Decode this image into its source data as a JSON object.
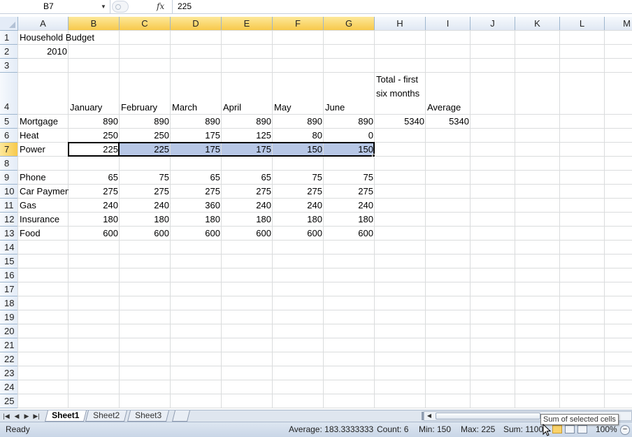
{
  "formula_bar": {
    "name_box": "B7",
    "fx_label": "fx",
    "content": "225"
  },
  "columns": [
    "A",
    "B",
    "C",
    "D",
    "E",
    "F",
    "G",
    "H",
    "I",
    "J",
    "K",
    "L",
    "M"
  ],
  "rows": [
    "1",
    "2",
    "3",
    "4",
    "5",
    "6",
    "7",
    "8",
    "9",
    "10",
    "11",
    "12",
    "13",
    "14",
    "15",
    "16",
    "17",
    "18",
    "19",
    "20",
    "21",
    "22",
    "23",
    "24",
    "25"
  ],
  "sheet": {
    "A1": "Household Budget",
    "A2": "2010",
    "B4": "January",
    "C4": "February",
    "D4": "March",
    "E4": "April",
    "F4": "May",
    "G4": "June",
    "H4": "Total - first six months",
    "I4": "Average",
    "A5": "Mortgage",
    "B5": "890",
    "C5": "890",
    "D5": "890",
    "E5": "890",
    "F5": "890",
    "G5": "890",
    "H5": "5340",
    "I5": "5340",
    "A6": "Heat",
    "B6": "250",
    "C6": "250",
    "D6": "175",
    "E6": "125",
    "F6": "80",
    "G6": "0",
    "A7": "Power",
    "B7": "225",
    "C7": "225",
    "D7": "175",
    "E7": "175",
    "F7": "150",
    "G7": "150",
    "A9": "Phone",
    "B9": "65",
    "C9": "75",
    "D9": "65",
    "E9": "65",
    "F9": "75",
    "G9": "75",
    "A10": "Car Payment",
    "B10": "275",
    "C10": "275",
    "D10": "275",
    "E10": "275",
    "F10": "275",
    "G10": "275",
    "A11": "Gas",
    "B11": "240",
    "C11": "240",
    "D11": "360",
    "E11": "240",
    "F11": "240",
    "G11": "240",
    "A12": "Insurance",
    "B12": "180",
    "C12": "180",
    "D12": "180",
    "E12": "180",
    "F12": "180",
    "G12": "180",
    "A13": "Food",
    "B13": "600",
    "C13": "600",
    "D13": "600",
    "E13": "600",
    "F13": "600",
    "G13": "600"
  },
  "tabs": [
    {
      "label": "Sheet1",
      "active": true
    },
    {
      "label": "Sheet2",
      "active": false
    },
    {
      "label": "Sheet3",
      "active": false
    }
  ],
  "status": {
    "ready": "Ready",
    "average": "Average: 183.3333333",
    "count": "Count: 6",
    "min": "Min: 150",
    "max": "Max: 225",
    "sum": "Sum: 1100",
    "zoom": "100%"
  },
  "tooltip": "Sum of selected cells",
  "colors": {
    "selection_fill": "#b7c7e6",
    "header_selected": "#f7c94b",
    "gridline": "#dadcdd"
  }
}
